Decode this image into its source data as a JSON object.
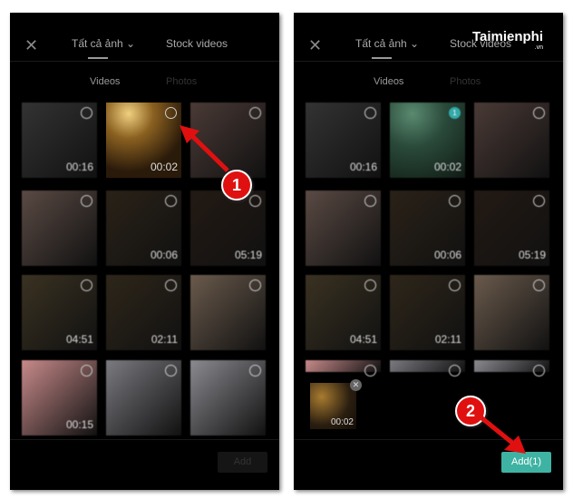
{
  "header": {
    "close_icon": "close-icon",
    "tabs": [
      "Tất cả ảnh",
      "Stock videos"
    ],
    "subtabs": [
      "Videos",
      "Photos"
    ]
  },
  "grid": [
    {
      "duration": "00:16",
      "color": "#333"
    },
    {
      "duration": "00:02",
      "color": "#7a5a2a"
    },
    {
      "duration": "",
      "color": "#4a3a36"
    },
    {
      "duration": "",
      "color": "#5a4a44"
    },
    {
      "duration": "00:06",
      "color": "#2a2218"
    },
    {
      "duration": "05:19",
      "color": "#231a14"
    },
    {
      "duration": "04:51",
      "color": "#3a3222"
    },
    {
      "duration": "02:11",
      "color": "#2e261a"
    },
    {
      "duration": "",
      "color": "#6a5a4c"
    },
    {
      "duration": "00:15",
      "color": "#c88a8a"
    },
    {
      "duration": "",
      "color": "#7a7a80"
    },
    {
      "duration": "",
      "color": "#8a8a90"
    }
  ],
  "left": {
    "add_label": "Add",
    "step": "1"
  },
  "right": {
    "selected_count": "1",
    "add_label": "Add(1)",
    "step": "2",
    "tray_duration": "00:02",
    "logo": "Taimienphi",
    "logo_sub": ".vn"
  },
  "colors": {
    "accent": "#3fb3a3",
    "marker": "#e01010"
  }
}
